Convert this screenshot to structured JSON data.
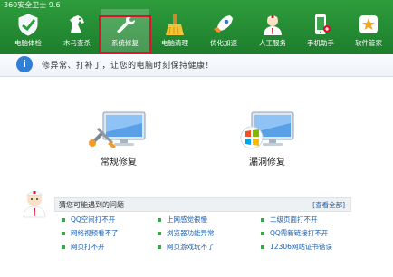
{
  "window": {
    "title": "360安全卫士 9.6"
  },
  "nav": {
    "items": [
      {
        "label": "电脑体检"
      },
      {
        "label": "木马查杀"
      },
      {
        "label": "系统修复"
      },
      {
        "label": "电脑清理"
      },
      {
        "label": "优化加速"
      },
      {
        "label": "人工服务"
      },
      {
        "label": "手机助手"
      },
      {
        "label": "软件管家"
      }
    ],
    "active_index": 2
  },
  "banner": {
    "text": "修异常、打补丁，让您的电脑时刻保持健康！"
  },
  "repair": {
    "normal_label": "常规修复",
    "vuln_label": "漏洞修复"
  },
  "questions": {
    "title": "猜您可能遇到的问题",
    "view_all": "[查看全部]",
    "items": [
      "QQ空间打不开",
      "上网感觉很慢",
      "二级页面打不开",
      "网络视频看不了",
      "浏览器功能异常",
      "QQ需新链接打不开",
      "网页打不开",
      "网页游戏玩不了",
      "12306网站证书错误"
    ]
  },
  "colors": {
    "header_green": "#1d7d2c",
    "highlight_red": "#e0102a",
    "link_blue": "#1a5fb4"
  }
}
